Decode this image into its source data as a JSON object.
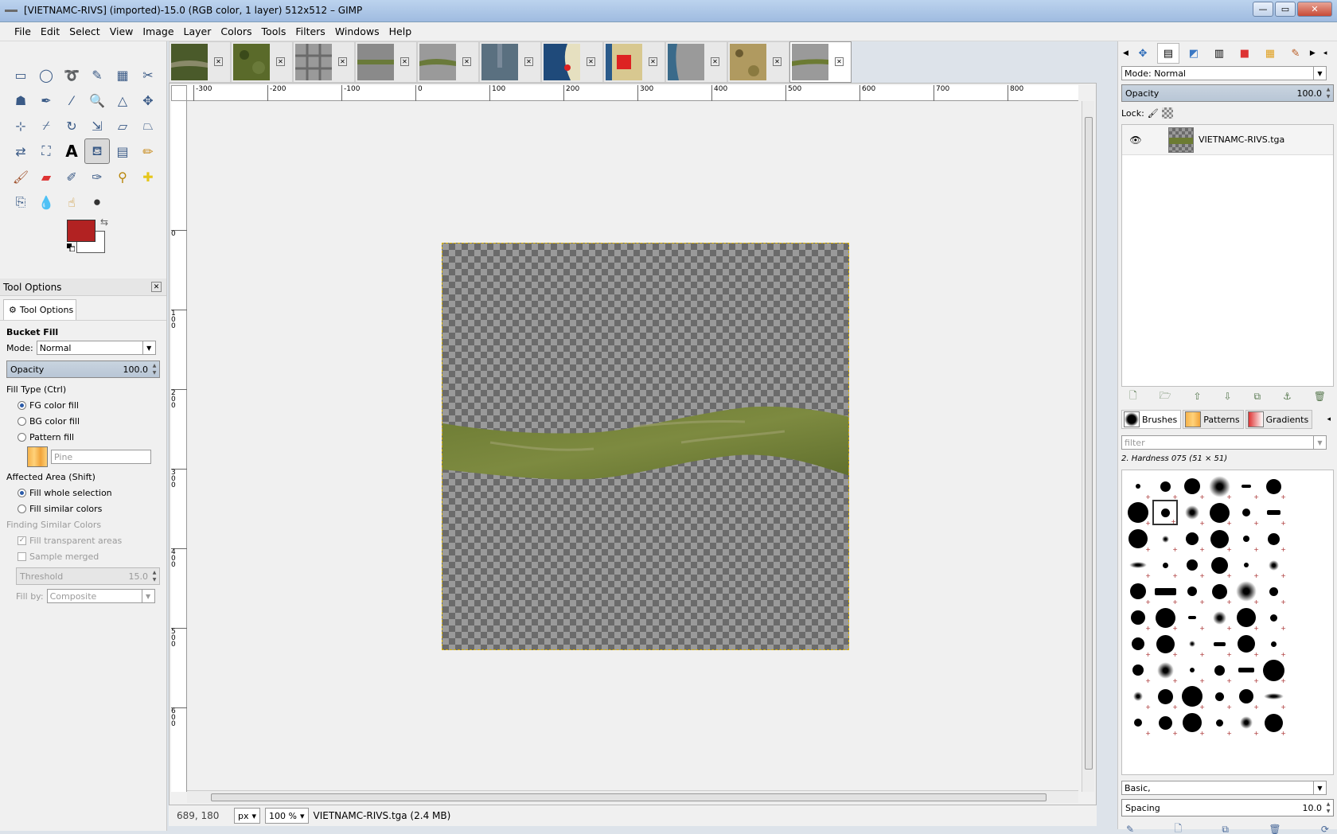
{
  "window": {
    "title": "[VIETNAMC-RIVS] (imported)-15.0 (RGB color, 1 layer) 512x512 – GIMP",
    "minimize": "—",
    "maximize": "▭",
    "close": "✕"
  },
  "menubar": [
    "File",
    "Edit",
    "Select",
    "View",
    "Image",
    "Layer",
    "Colors",
    "Tools",
    "Filters",
    "Windows",
    "Help"
  ],
  "colors": {
    "fg": "#b22222",
    "bg": "#ffffff"
  },
  "tool_options": {
    "panel_title": "Tool Options",
    "tab_label": "Tool Options",
    "tool_name": "Bucket Fill",
    "mode_label": "Mode:",
    "mode_value": "Normal",
    "opacity_label": "Opacity",
    "opacity_value": "100.0",
    "fill_type_label": "Fill Type  (Ctrl)",
    "fill_options": [
      "FG color fill",
      "BG color fill",
      "Pattern fill"
    ],
    "pattern_name": "Pine",
    "affected_area_label": "Affected Area  (Shift)",
    "area_options": [
      "Fill whole selection",
      "Fill similar colors"
    ],
    "finding_label": "Finding Similar Colors",
    "fill_transparent": "Fill transparent areas",
    "sample_merged": "Sample merged",
    "threshold_label": "Threshold",
    "threshold_value": "15.0",
    "fill_by_label": "Fill by:",
    "fill_by_value": "Composite"
  },
  "image_tabs_count": 11,
  "rulers": {
    "h_labels": [
      "-300",
      "-200",
      "-100",
      "0",
      "100",
      "200",
      "300",
      "400",
      "500",
      "600",
      "700",
      "800"
    ],
    "v_labels": [
      "0",
      "100",
      "200",
      "300",
      "400",
      "500",
      "600"
    ]
  },
  "status": {
    "coords": "689, 180",
    "unit": "px",
    "zoom": "100 %",
    "file_info": "VIETNAMC-RIVS.tga (2.4 MB)"
  },
  "layers": {
    "mode_label": "Mode:",
    "mode_value": "Normal",
    "opacity_label": "Opacity",
    "opacity_value": "100.0",
    "lock_label": "Lock:",
    "items": [
      {
        "name": "VIETNAMC-RIVS.tga"
      }
    ]
  },
  "brushes": {
    "tabs": [
      "Brushes",
      "Patterns",
      "Gradients"
    ],
    "filter_placeholder": "filter",
    "selected_brush": "2. Hardness 075 (51 × 51)",
    "tag_value": "Basic,",
    "spacing_label": "Spacing",
    "spacing_value": "10.0"
  }
}
